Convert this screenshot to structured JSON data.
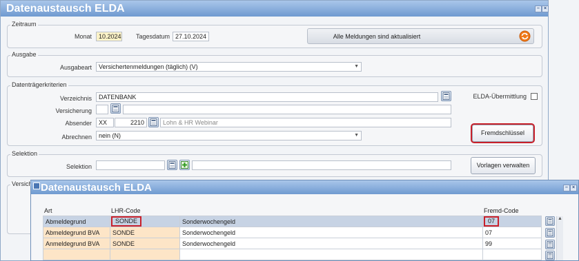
{
  "main_window": {
    "title": "Datenaustausch ELDA",
    "zeitraum": {
      "group_label": "Zeitraum",
      "monat_label": "Monat",
      "monat_value": "10.2024",
      "tagesdatum_label": "Tagesdatum",
      "tagesdatum_value": "27.10.2024",
      "status_text": "Alle Meldungen sind aktualisiert"
    },
    "ausgabe": {
      "group_label": "Ausgabe",
      "ausgabeart_label": "Ausgabeart",
      "ausgabeart_value": "Versichertenmeldungen (täglich) (V)"
    },
    "datentraeger": {
      "group_label": "Datenträgerkriterien",
      "verzeichnis_label": "Verzeichnis",
      "verzeichnis_value": "DATENBANK",
      "elda_label": "ELDA-Übermittlung",
      "versicherung_label": "Versicherung",
      "versicherung_value": "",
      "absender_label": "Absender",
      "absender_code": "XX",
      "absender_number": "2210",
      "absender_name": "Lohn & HR Webinar",
      "abrechnen_label": "Abrechnen",
      "abrechnen_value": "nein (N)",
      "fremdschluessel_label": "Fremdschlüssel"
    },
    "selektion": {
      "group_label": "Selektion",
      "selektion_label": "Selektion",
      "vorlagen_label": "Vorlagen verwalten"
    },
    "partial_group_label": "Versich"
  },
  "popup_window": {
    "title": "Datenaustausch ELDA",
    "columns": [
      "Art",
      "LHR-Code",
      "",
      "Fremd-Code"
    ],
    "rows": [
      {
        "art": "Abmeldegrund",
        "lhr": "SONDE",
        "desc": "Sonderwochengeld",
        "fremd": "07",
        "selected": true
      },
      {
        "art": "Abmeldegrund BVA",
        "lhr": "SONDE",
        "desc": "Sonderwochengeld",
        "fremd": "07",
        "selected": false
      },
      {
        "art": "Anmeldegrund BVA",
        "lhr": "SONDE",
        "desc": "Sonderwochengeld",
        "fremd": "99",
        "selected": false
      },
      {
        "art": "",
        "lhr": "",
        "desc": "",
        "fremd": "",
        "selected": false
      }
    ]
  },
  "colors": {
    "title_gradient_top": "#a9c6ea",
    "title_gradient_bottom": "#6f9ad0",
    "highlight_red": "#c8202a",
    "selected_row": "#c7d3e4",
    "orange_cell": "#fde5c7",
    "yellow_field": "#fdf3c8",
    "refresh_icon": "#f07a1a"
  }
}
